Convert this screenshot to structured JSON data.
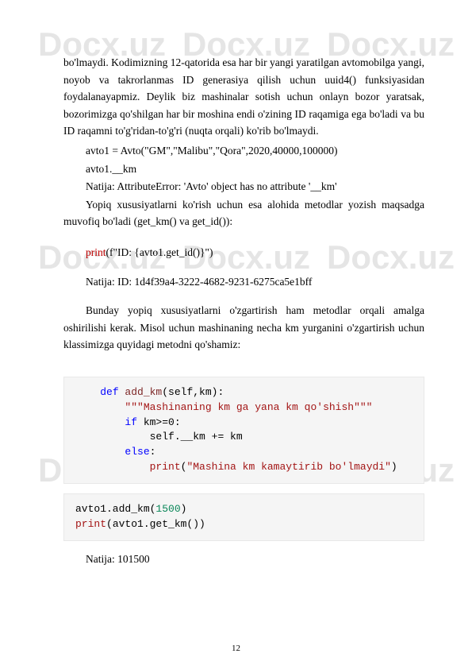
{
  "watermark": "Docx.uz",
  "para1": "bo'lmaydi. Kodimizning 12-qatorida esa har bir yangi yaratilgan avtomobilga yangi, noyob va takrorlanmas ID generasiya qilish uchun uuid4() funksiyasidan foydalanayapmiz. Deylik biz mashinalar sotish uchun onlayn bozor yaratsak, bozorimizga qo'shilgan har bir moshina endi o'zining ID raqamiga ega bo'ladi va bu ID raqamni to'g'ridan-to'g'ri (nuqta orqali) ko'rib bo'lmaydi.",
  "code1": "avto1 = Avto(\"GM\",\"Malibu\",\"Qora\",2020,40000,100000)",
  "code2": "avto1.__km",
  "result1": "Natija: AttributeError: 'Avto' object has no attribute '__km'",
  "para2": "Yopiq xususiyatlarni ko'rish uchun esa alohida metodlar yozish maqsadga muvofiq bo'ladi (get_km() va get_id()):",
  "print_kw": "print",
  "print_arg": "(f\"ID: {avto1.get_id()}\")",
  "result2": "Natija: ID: 1d4f39a4-3222-4682-9231-6275ca5e1bff",
  "para3": "Bunday yopiq xususiyatlarni o'zgartirish ham metodlar orqali amalga oshirilishi kerak. Misol uchun mashinaning necha km yurganini o'zgartirish uchun klassimizga quyidagi metodni qo'shamiz:",
  "codeblock1": {
    "l1_def": "def",
    "l1_name": " add_km",
    "l1_rest": "(self,km):",
    "l2": "\"\"\"Mashinaning km ga yana km qo'shish\"\"\"",
    "l3_if": "if",
    "l3_rest": " km>=0:",
    "l4": "self.__km += km",
    "l5_else": "else",
    "l5_rest": ":",
    "l6_print": "print",
    "l6_rest": "(",
    "l6_str": "\"Mashina km kamaytirib bo'lmaydi\"",
    "l6_close": ")"
  },
  "codeblock2": {
    "l1a": "avto1.add_km(",
    "l1num": "1500",
    "l1b": ")",
    "l2_print": "print",
    "l2_rest": "(avto1.get_km())"
  },
  "result3": "Natija: 101500",
  "page_number": "12"
}
